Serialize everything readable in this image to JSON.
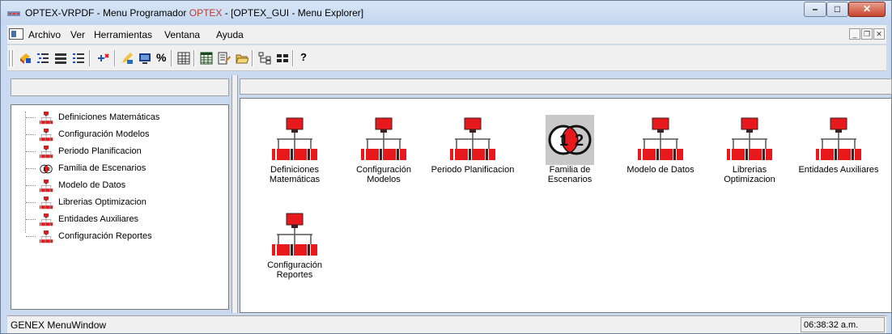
{
  "window": {
    "title_prefix": "OPTEX-VRPDF - Menu Programador ",
    "title_highlight": "OPTEX",
    "title_suffix": " - [OPTEX_GUI - Menu Explorer]",
    "controls": {
      "minimize": "–",
      "maximize": "□",
      "close": "✕"
    }
  },
  "menubar": {
    "items": [
      "Archivo",
      "Ver",
      "Herramientas",
      "Ventana",
      "Ayuda"
    ],
    "mdi_controls": {
      "minimize": "_",
      "restore": "❐",
      "close": "✕"
    }
  },
  "toolbar": {
    "help_label": "?"
  },
  "tree": {
    "items": [
      {
        "label": "Definiciones Matemáticas",
        "icon": "network-icon"
      },
      {
        "label": "Configuración Modelos",
        "icon": "network-icon"
      },
      {
        "label": "Periodo Planificacion",
        "icon": "network-icon"
      },
      {
        "label": "Familia de Escenarios",
        "icon": "scenario-icon"
      },
      {
        "label": "Modelo de Datos",
        "icon": "network-icon"
      },
      {
        "label": "Librerias Optimizacion",
        "icon": "network-icon"
      },
      {
        "label": "Entidades Auxiliares",
        "icon": "network-icon"
      },
      {
        "label": "Configuración Reportes",
        "icon": "network-icon"
      }
    ]
  },
  "explorer": {
    "items": [
      {
        "label_line1": "Definiciones",
        "label_line2": "Matemáticas",
        "icon": "network-icon"
      },
      {
        "label_line1": "Configuración",
        "label_line2": "Modelos",
        "icon": "network-icon"
      },
      {
        "label_line1": "Periodo Planificacion",
        "label_line2": "",
        "icon": "network-icon"
      },
      {
        "label_line1": "Familia de",
        "label_line2": "Escenarios",
        "icon": "scenario-icon",
        "selected": true
      },
      {
        "label_line1": "Modelo de Datos",
        "label_line2": "",
        "icon": "network-icon"
      },
      {
        "label_line1": "Librerias",
        "label_line2": "Optimizacion",
        "icon": "network-icon"
      },
      {
        "label_line1": "Entidades Auxiliares",
        "label_line2": "",
        "icon": "network-icon"
      },
      {
        "label_line1": "Configuración",
        "label_line2": "Reportes",
        "icon": "network-icon"
      }
    ]
  },
  "statusbar": {
    "text": "GENEX MenuWindow",
    "time": "06:38:32 a.m."
  },
  "colors": {
    "icon_red": "#e8191d",
    "icon_dark": "#3a2020",
    "accent_title": "#c0392b"
  }
}
